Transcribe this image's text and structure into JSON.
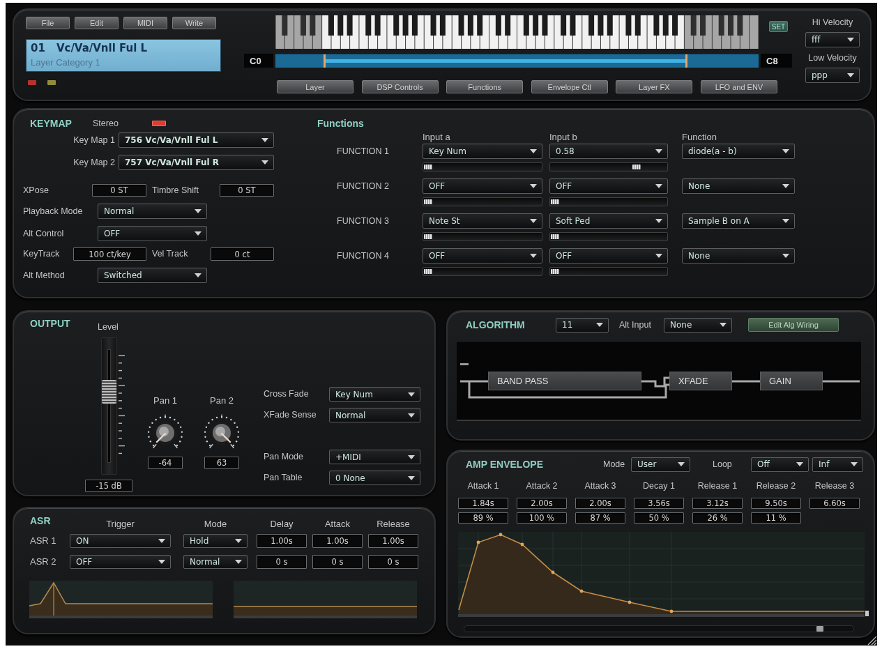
{
  "menu": [
    "File",
    "Edit",
    "MIDI",
    "Write"
  ],
  "program": {
    "number": "01",
    "name": "Vc/Va/Vnll Ful L",
    "category": "Layer Category 1"
  },
  "status_leds": [
    {
      "color": "#b5332c"
    },
    {
      "color": "#8f8c3c"
    }
  ],
  "keyboard": {
    "low_label": "C0",
    "high_label": "C8",
    "low_handle": {
      "level": 0.102
    },
    "high_handle": {
      "level": 0.851
    }
  },
  "set_button": "SET",
  "page_tabs": [
    {
      "label": "Layer",
      "selected": false
    },
    {
      "label": "DSP Controls",
      "selected": false
    },
    {
      "label": "Functions",
      "selected": false
    },
    {
      "label": "Envelope Ctl",
      "selected": false
    },
    {
      "label": "Layer FX",
      "selected": false
    },
    {
      "label": "LFO and ENV",
      "selected": false
    }
  ],
  "velocity": [
    {
      "label": "Hi Velocity",
      "value": "fff"
    },
    {
      "label": "Low Velocity",
      "value": "ppp"
    }
  ],
  "keymap": {
    "title": "KEYMAP",
    "stereo": {
      "label": "Stereo",
      "on": true
    },
    "key_maps": [
      {
        "label": "Key Map 1",
        "value": "756 Vc/Va/Vnll Ful L"
      },
      {
        "label": "Key Map 2",
        "value": "757 Vc/Va/Vnll Ful R"
      }
    ],
    "transpose": [
      {
        "label": "XPose",
        "value": "0 ST"
      },
      {
        "label": "Timbre Shift",
        "value": "0 ST"
      }
    ],
    "playback_mode": {
      "label": "Playback Mode",
      "value": "Normal"
    },
    "alt_control": {
      "label": "Alt Control",
      "value": "OFF"
    },
    "tracking": [
      {
        "label": "KeyTrack",
        "value": "100 ct/key"
      },
      {
        "label": "Vel Track",
        "value": "0 ct"
      }
    ],
    "alt_method": {
      "label": "Alt Method",
      "value": "Switched"
    }
  },
  "functions": {
    "title": "Functions",
    "columns": [
      "Input a",
      "Input b",
      "Function"
    ],
    "rows": [
      {
        "label": "FUNCTION 1",
        "input_a": {
          "value": "Key Num",
          "level": 0
        },
        "input_b": {
          "value": "0.58",
          "level": 0.76
        },
        "function": "diode(a - b)"
      },
      {
        "label": "FUNCTION 2",
        "input_a": {
          "value": "OFF",
          "level": 0
        },
        "input_b": {
          "value": "OFF",
          "level": 0
        },
        "function": "None"
      },
      {
        "label": "FUNCTION 3",
        "input_a": {
          "value": "Note St",
          "level": 0
        },
        "input_b": {
          "value": "Soft Ped",
          "level": 0
        },
        "function": "Sample B on A"
      },
      {
        "label": "FUNCTION 4",
        "input_a": {
          "value": "OFF",
          "level": 0
        },
        "input_b": {
          "value": "OFF",
          "level": 0
        },
        "function": "None"
      }
    ]
  },
  "output": {
    "title": "OUTPUT",
    "fader": {
      "label": "Level",
      "level": 0.63,
      "value": "-15 dB"
    },
    "pans": [
      {
        "label": "Pan 1",
        "value": "-64"
      },
      {
        "label": "Pan 2",
        "value": "63"
      }
    ],
    "crossfade": [
      {
        "label": "Cross Fade",
        "value": "Key Num"
      },
      {
        "label": "XFade Sense",
        "value": "Normal"
      }
    ],
    "pan_settings": [
      {
        "label": "Pan Mode",
        "value": "+MIDI"
      },
      {
        "label": "Pan Table",
        "value": "0 None"
      }
    ]
  },
  "asr": {
    "title": "ASR",
    "columns": [
      "Trigger",
      "Mode",
      "Delay",
      "Attack",
      "Release"
    ],
    "rows": [
      {
        "label": "ASR 1",
        "trigger": "ON",
        "mode": "Hold",
        "delay": "1.00s",
        "attack": "1.00s",
        "release": "1.00s"
      },
      {
        "label": "ASR 2",
        "trigger": "OFF",
        "mode": "Normal",
        "delay": "0 s",
        "attack": "0 s",
        "release": "0 s"
      }
    ]
  },
  "algorithm": {
    "title": "ALGORITHM",
    "number": "11",
    "alt_input": {
      "label": "Alt Input",
      "value": "None"
    },
    "edit_button": "Edit Alg Wiring",
    "blocks": [
      "BAND PASS",
      "XFADE",
      "GAIN"
    ]
  },
  "amp_envelope": {
    "title": "AMP ENVELOPE",
    "mode": {
      "label": "Mode",
      "value": "User"
    },
    "loop": {
      "label": "Loop",
      "value": "Off",
      "count": "Inf"
    },
    "segments": [
      {
        "label": "Attack 1",
        "time": "1.84s",
        "percent": "89 %"
      },
      {
        "label": "Attack 2",
        "time": "2.00s",
        "percent": "100 %"
      },
      {
        "label": "Attack 3",
        "time": "2.00s",
        "percent": "87 %"
      },
      {
        "label": "Decay 1",
        "time": "3.56s",
        "percent": "50 %"
      },
      {
        "label": "Release 1",
        "time": "3.12s",
        "percent": "26 %"
      },
      {
        "label": "Release 2",
        "time": "9.50s",
        "percent": "11 %"
      },
      {
        "label": "Release 3",
        "time": "6.60s"
      }
    ]
  }
}
